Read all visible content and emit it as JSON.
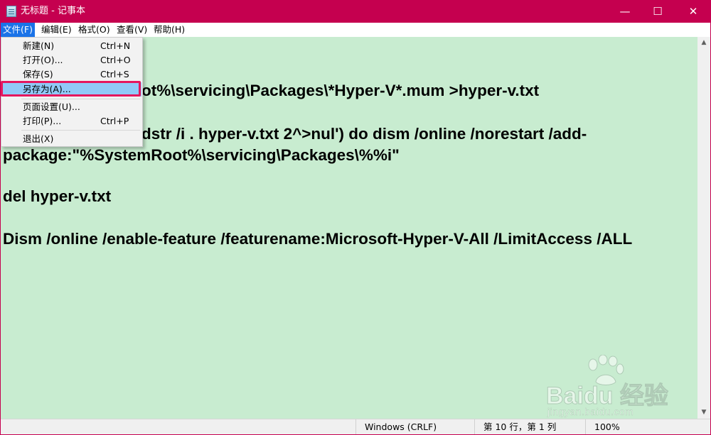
{
  "window": {
    "title": "无标题 - 记事本",
    "minimize_glyph": "—",
    "maximize_glyph": "☐",
    "close_glyph": "✕"
  },
  "menubar": {
    "items": [
      {
        "label": "文件(F)"
      },
      {
        "label": "编辑(E)"
      },
      {
        "label": "格式(O)"
      },
      {
        "label": "查看(V)"
      },
      {
        "label": "帮助(H)"
      }
    ]
  },
  "file_menu": {
    "items": [
      {
        "label": "新建(N)",
        "shortcut": "Ctrl+N"
      },
      {
        "label": "打开(O)...",
        "shortcut": "Ctrl+O"
      },
      {
        "label": "保存(S)",
        "shortcut": "Ctrl+S"
      },
      {
        "label": "另存为(A)...",
        "shortcut": ""
      },
      {
        "label": "页面设置(U)...",
        "shortcut": ""
      },
      {
        "label": "打印(P)...",
        "shortcut": "Ctrl+P"
      },
      {
        "label": "退出(X)",
        "shortcut": ""
      }
    ]
  },
  "editor": {
    "lines": [
      "ot%\\servicing\\Packages\\*Hyper-V*.mum >hyper-v.txt",
      "dstr /i . hyper-v.txt 2^>nul') do dism /online /norestart /add-",
      "package:\"%SystemRoot%\\servicing\\Packages\\%%i\"",
      "del hyper-v.txt",
      "Dism /online /enable-feature /featurename:Microsoft-Hyper-V-All /LimitAccess /ALL"
    ]
  },
  "statusbar": {
    "line_ending": "Windows (CRLF)",
    "position": "第 10 行，第 1 列",
    "zoom": "100%"
  },
  "watermark": {
    "brand": "Baidu 经验",
    "site": "jingyan.baidu.com"
  },
  "colors": {
    "titlebar": "#c5004f",
    "editor_bg": "#c8ecd0",
    "menu_active": "#1a73e8",
    "menu_highlight": "#91c9f7",
    "annotation_box": "#e5175e"
  }
}
